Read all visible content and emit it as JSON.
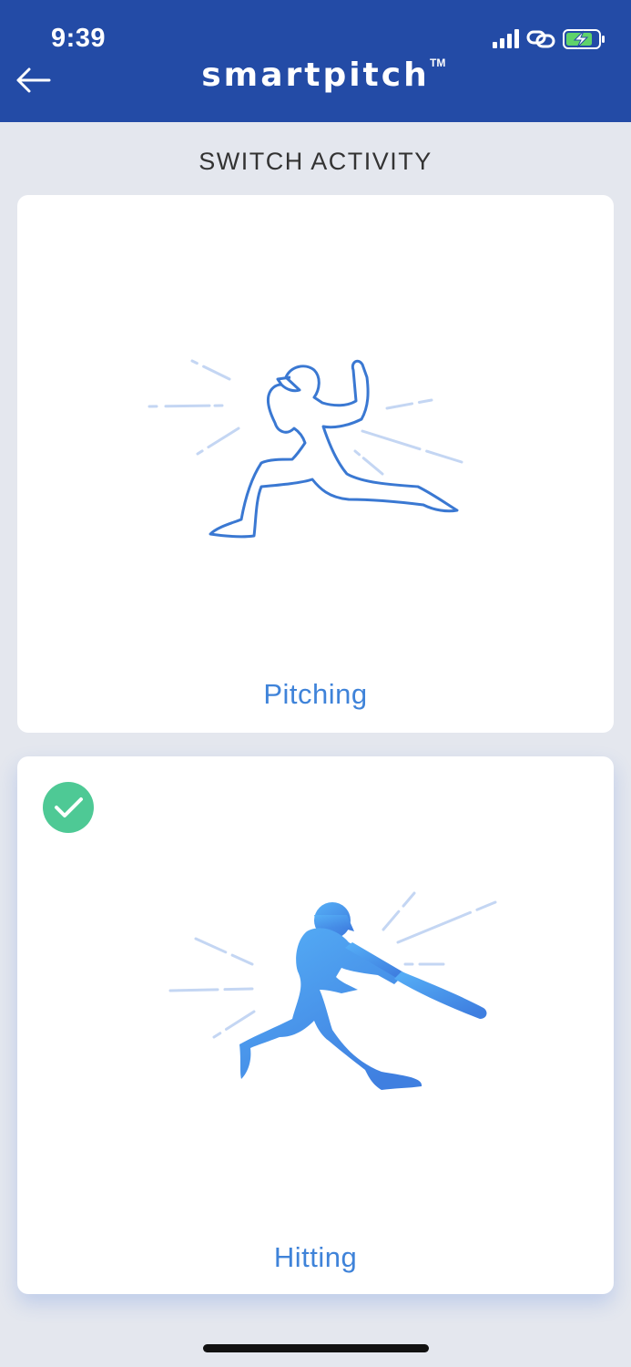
{
  "status_bar": {
    "time": "9:39",
    "icons": [
      "cellular-signal-icon",
      "link-icon",
      "battery-charging-icon"
    ]
  },
  "header": {
    "back_icon": "arrow-left-icon",
    "logo_text": "smartpitch",
    "logo_tm": "TM",
    "background": "#234ba6"
  },
  "page": {
    "title": "SWITCH ACTIVITY"
  },
  "activities": [
    {
      "label": "Pitching",
      "icon": "pitcher-outline-icon",
      "selected": false
    },
    {
      "label": "Hitting",
      "icon": "batter-silhouette-icon",
      "selected": true,
      "check_icon": "check-circle-icon"
    }
  ],
  "colors": {
    "accent": "#3f83d9",
    "selected_check": "#4ec995",
    "background": "#e4e7ee",
    "card": "#ffffff"
  }
}
